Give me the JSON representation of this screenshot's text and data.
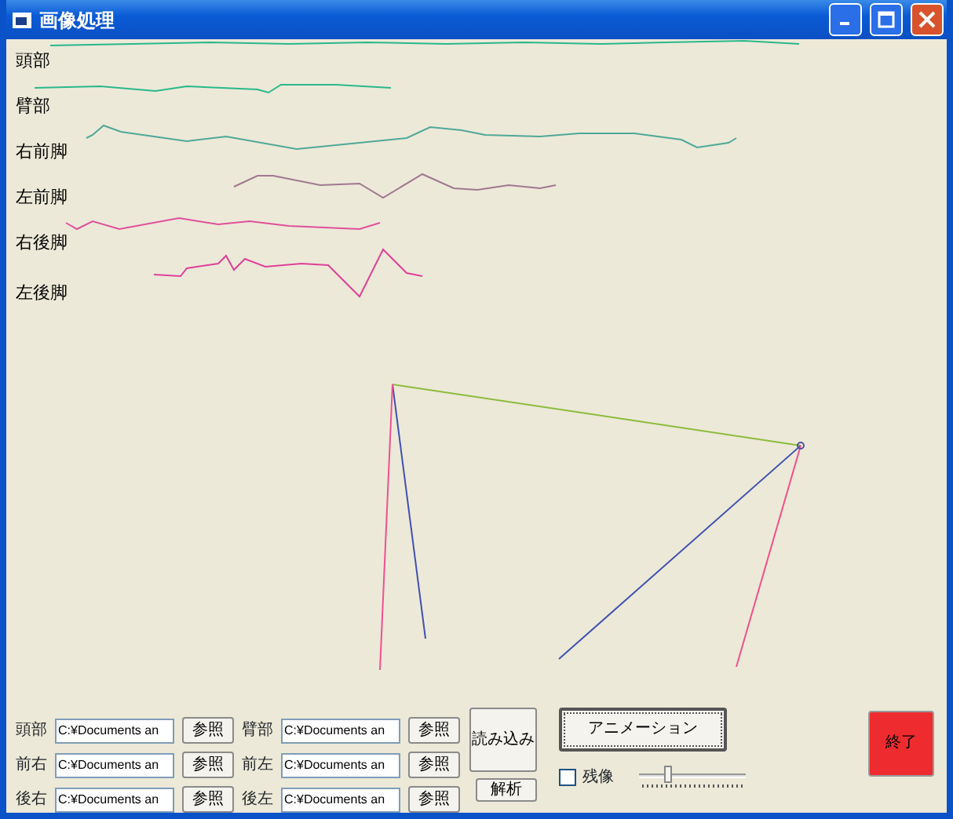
{
  "window": {
    "title": "画像処理"
  },
  "trace_labels": [
    "頭部",
    "臂部",
    "右前脚",
    "左前脚",
    "右後脚",
    "左後脚"
  ],
  "file_rows": [
    {
      "label": "頭部",
      "value": "C:¥Documents an",
      "button": "参照"
    },
    {
      "label": "臂部",
      "value": "C:¥Documents an",
      "button": "参照"
    },
    {
      "label": "前右",
      "value": "C:¥Documents an",
      "button": "参照"
    },
    {
      "label": "前左",
      "value": "C:¥Documents an",
      "button": "参照"
    },
    {
      "label": "後右",
      "value": "C:¥Documents an",
      "button": "参照"
    },
    {
      "label": "後左",
      "value": "C:¥Documents an",
      "button": "参照"
    }
  ],
  "load_button": "読み込み",
  "analyze_button": "解析",
  "animation_button": "アニメーション",
  "afterimage": {
    "label": "残像",
    "checked": false
  },
  "slider": {
    "level": 0.25
  },
  "exit_button": "終了"
}
